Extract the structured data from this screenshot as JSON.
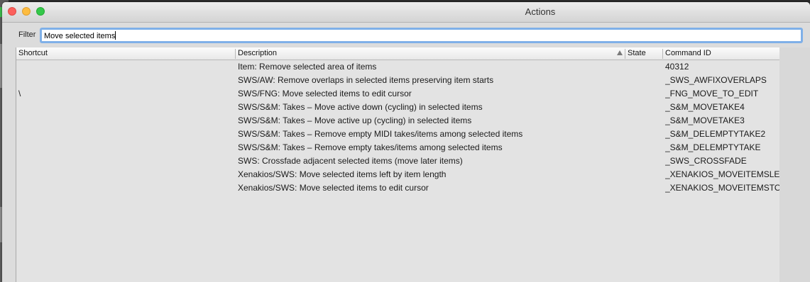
{
  "window": {
    "title": "Actions"
  },
  "filter": {
    "label": "Filter",
    "value": "Move selected items"
  },
  "columns": {
    "shortcut": "Shortcut",
    "description": "Description",
    "state": "State",
    "command_id": "Command ID"
  },
  "sort": {
    "column": "Description",
    "direction": "ascending"
  },
  "rows": [
    {
      "shortcut": "",
      "description": "Item: Remove selected area of items",
      "state": "",
      "command_id": "40312"
    },
    {
      "shortcut": "",
      "description": "SWS/AW: Remove overlaps in selected items preserving item starts",
      "state": "",
      "command_id": "_SWS_AWFIXOVERLAPS"
    },
    {
      "shortcut": "\\",
      "description": "SWS/FNG: Move selected items to edit cursor",
      "state": "",
      "command_id": "_FNG_MOVE_TO_EDIT"
    },
    {
      "shortcut": "",
      "description": "SWS/S&M: Takes – Move active down (cycling) in selected items",
      "state": "",
      "command_id": "_S&M_MOVETAKE4"
    },
    {
      "shortcut": "",
      "description": "SWS/S&M: Takes – Move active up (cycling) in selected items",
      "state": "",
      "command_id": "_S&M_MOVETAKE3"
    },
    {
      "shortcut": "",
      "description": "SWS/S&M: Takes – Remove empty MIDI takes/items among selected items",
      "state": "",
      "command_id": "_S&M_DELEMPTYTAKE2"
    },
    {
      "shortcut": "",
      "description": "SWS/S&M: Takes – Remove empty takes/items among selected items",
      "state": "",
      "command_id": "_S&M_DELEMPTYTAKE"
    },
    {
      "shortcut": "",
      "description": "SWS: Crossfade adjacent selected items (move later items)",
      "state": "",
      "command_id": "_SWS_CROSSFADE"
    },
    {
      "shortcut": "",
      "description": "Xenakios/SWS: Move selected items left by item length",
      "state": "",
      "command_id": "_XENAKIOS_MOVEITEMSLEFT"
    },
    {
      "shortcut": "",
      "description": "Xenakios/SWS: Move selected items to edit cursor",
      "state": "",
      "command_id": "_XENAKIOS_MOVEITEMSTOE"
    }
  ]
}
